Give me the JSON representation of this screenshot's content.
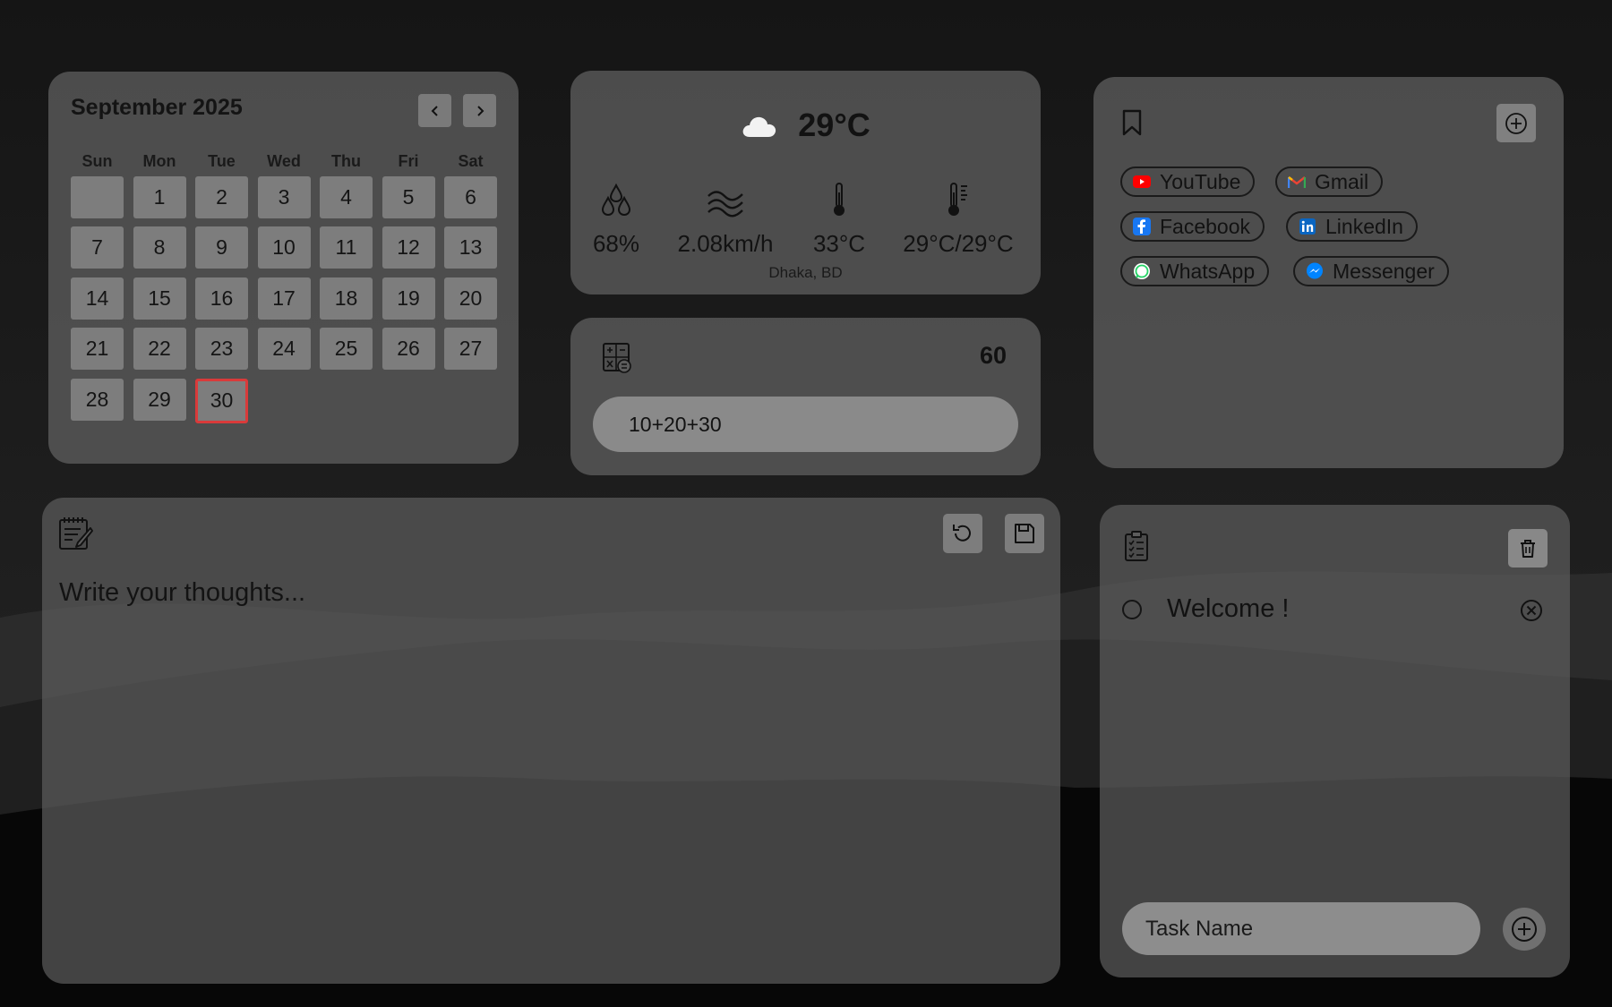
{
  "calendar": {
    "title": "September 2025",
    "weekdays": [
      "Sun",
      "Mon",
      "Tue",
      "Wed",
      "Thu",
      "Fri",
      "Sat"
    ],
    "leading_empty": 1,
    "days": [
      1,
      2,
      3,
      4,
      5,
      6,
      7,
      8,
      9,
      10,
      11,
      12,
      13,
      14,
      15,
      16,
      17,
      18,
      19,
      20,
      21,
      22,
      23,
      24,
      25,
      26,
      27,
      28,
      29,
      30
    ],
    "today": 30,
    "today_color": "#d93a3a"
  },
  "weather": {
    "icon": "cloud-icon",
    "temperature": "29°C",
    "humidity": "68%",
    "wind": "2.08km/h",
    "feels_like": "33°C",
    "min_max": "29°C/29°C",
    "location": "Dhaka, BD"
  },
  "calculator": {
    "result": "60",
    "expression": "10+20+30"
  },
  "bookmarks": {
    "items": [
      {
        "label": "YouTube",
        "icon": "youtube-icon",
        "color": "#ff0000"
      },
      {
        "label": "Gmail",
        "icon": "gmail-icon",
        "color": "#ea4335"
      },
      {
        "label": "Facebook",
        "icon": "facebook-icon",
        "color": "#1877f2"
      },
      {
        "label": "LinkedIn",
        "icon": "linkedin-icon",
        "color": "#0a66c2"
      },
      {
        "label": "WhatsApp",
        "icon": "whatsapp-icon",
        "color": "#25d366"
      },
      {
        "label": "Messenger",
        "icon": "messenger-icon",
        "color": "#0084ff"
      }
    ]
  },
  "notes": {
    "placeholder": "Write your thoughts..."
  },
  "todo": {
    "items": [
      {
        "text": "Welcome !",
        "done": false
      }
    ],
    "input_placeholder": "Task Name"
  }
}
